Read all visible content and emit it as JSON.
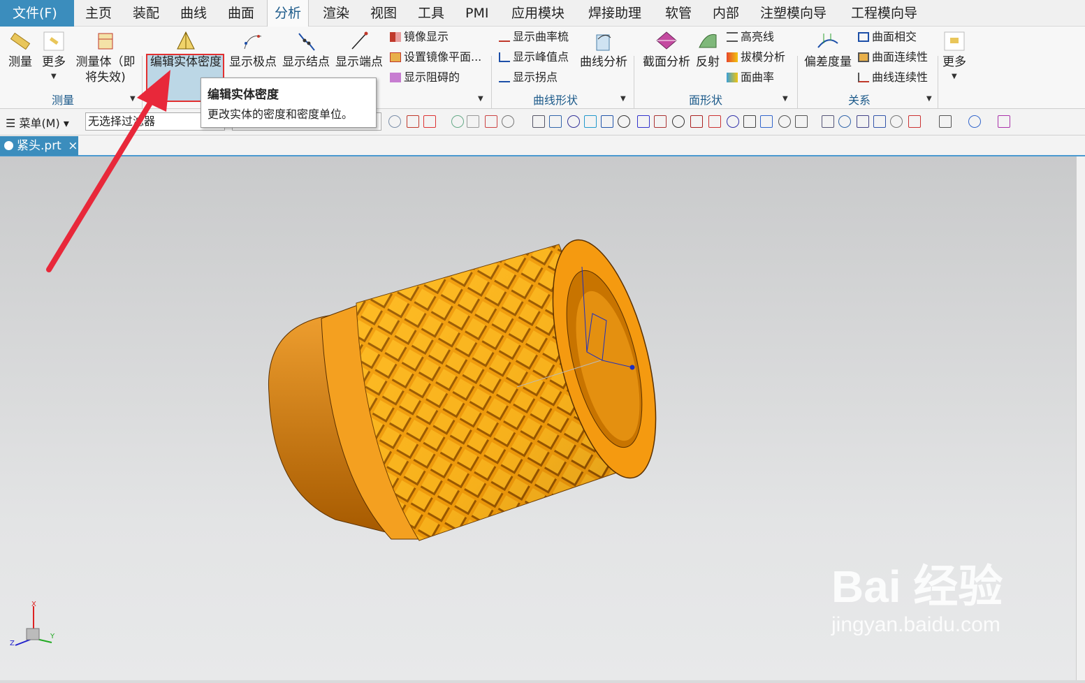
{
  "menubar": {
    "tabs": [
      "文件(F)",
      "主页",
      "装配",
      "曲线",
      "曲面",
      "分析",
      "渲染",
      "视图",
      "工具",
      "PMI",
      "应用模块",
      "焊接助理",
      "软管",
      "内部",
      "注塑模向导",
      "工程模向导"
    ]
  },
  "ribbon": {
    "measure": {
      "measure": "测量",
      "more": "更多",
      "measure_body_1": "测量体（即",
      "measure_body_2": "将失效)",
      "group": "测量"
    },
    "edit_density": "编辑实体密度",
    "show_poles": "显示极点",
    "show_knots": "显示结点",
    "show_endpoints": "显示端点",
    "mirror_display": "镜像显示",
    "set_mirror_plane": "设置镜像平面...",
    "show_blocked": "显示阻碍的",
    "curve": {
      "comb": "显示曲率梳",
      "peaks": "显示峰值点",
      "inflections": "显示拐点",
      "analysis": "曲线分析",
      "group": "曲线形状"
    },
    "face": {
      "section": "截面分析",
      "reflection": "反射",
      "highlight": "高亮线",
      "draft": "拔模分析",
      "curvature": "面曲率",
      "group": "面形状"
    },
    "relation": {
      "deviation": "偏差度量",
      "intersect": "曲面相交",
      "surface_cont": "曲面连续性",
      "curve_cont": "曲线连续性",
      "group": "关系"
    },
    "more": "更多"
  },
  "tooltip": {
    "title": "编辑实体密度",
    "desc": "更改实体的密度和密度单位。"
  },
  "toolbar": {
    "menu": "菜单(M)",
    "filter_value": "无选择过滤器"
  },
  "document": {
    "tab": "紧头.prt",
    "close": "×"
  },
  "triad": {
    "x": "X",
    "y": "Y",
    "z": "Z"
  },
  "watermark": {
    "brand": "Bai  经验",
    "site": "jingyan.baidu.com"
  }
}
